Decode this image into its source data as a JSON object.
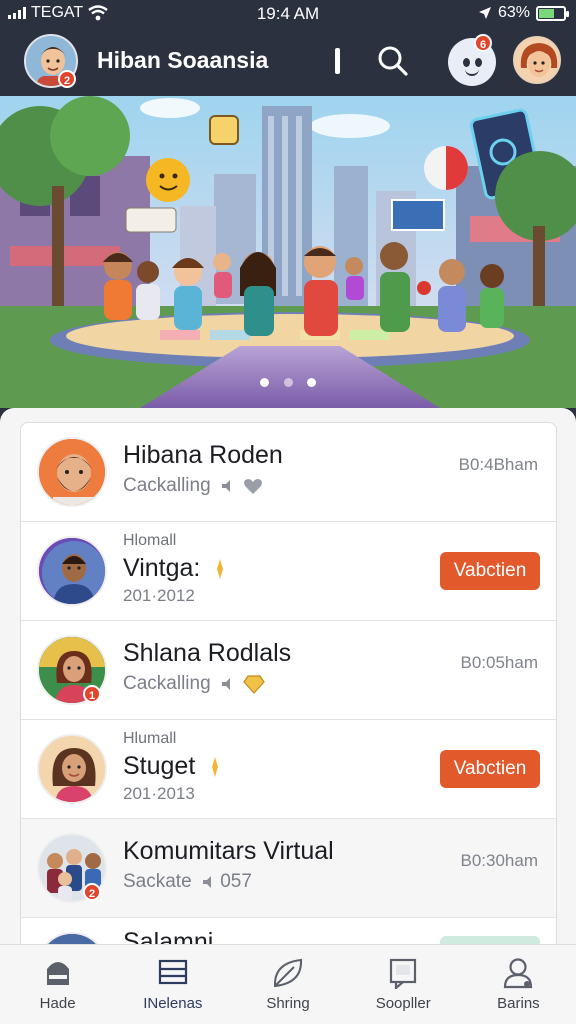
{
  "status_bar": {
    "carrier": "TEGAT",
    "time": "19:4 AM",
    "battery": "63%",
    "battery_level": 0.63
  },
  "header": {
    "title": "Hiban Soaansia",
    "avatar_badge": "2",
    "notification_badge": "6"
  },
  "banner": {
    "slide_count": 3,
    "active_slide": 1
  },
  "list": [
    {
      "name": "Hibana Roden",
      "subtitle": "Cackalling",
      "time": "B0:4Bham",
      "badge": ""
    },
    {
      "small": "Hlomall",
      "name": "Vintga:",
      "date": "201·2012",
      "action": "Vabctien"
    },
    {
      "name": "Shlana Rodlals",
      "subtitle": "Cackalling",
      "time": "B0:05ham",
      "badge": "1"
    },
    {
      "small": "Hlumall",
      "name": "Stuget",
      "date": "201·2013",
      "action": "Vabctien"
    },
    {
      "name": "Komumitars Virtual",
      "subtitle": "Sackate",
      "subtitle_extra": "057",
      "time": "B0:30ham",
      "badge": "2"
    },
    {
      "name": "Salamni"
    }
  ],
  "bottom_nav": [
    {
      "label": "Hade",
      "icon": "home-icon"
    },
    {
      "label": "INelenas",
      "icon": "list-icon"
    },
    {
      "label": "Shring",
      "icon": "leaf-icon"
    },
    {
      "label": "Soopller",
      "icon": "sticker-icon"
    },
    {
      "label": "Barins",
      "icon": "profile-icon"
    }
  ],
  "colors": {
    "header_bg": "#2c3140",
    "accent": "#e2592c",
    "badge": "#e3422b"
  }
}
